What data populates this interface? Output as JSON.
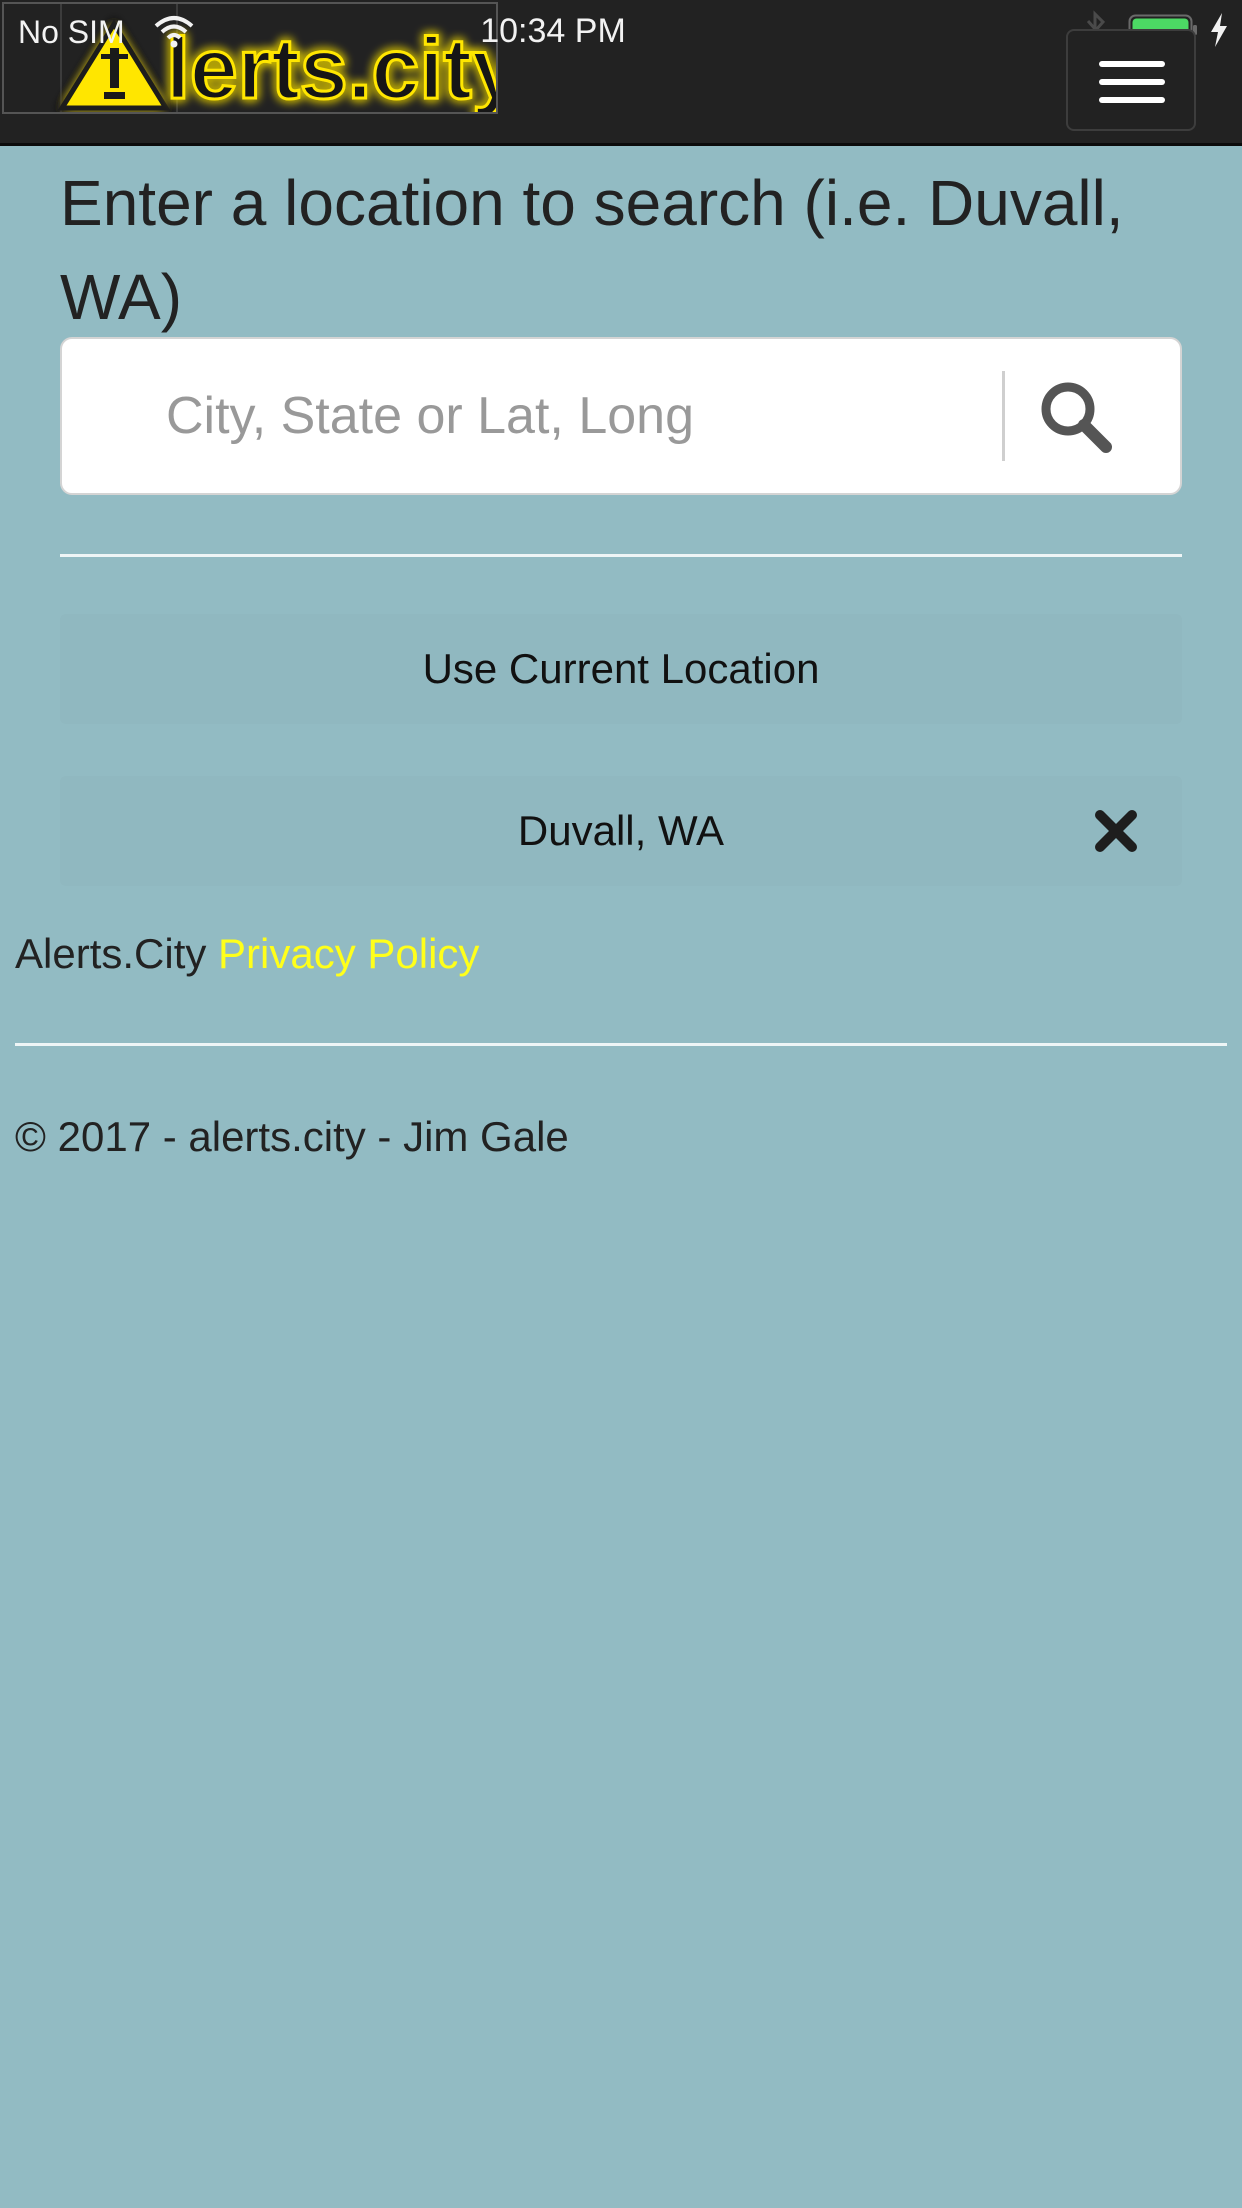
{
  "status_bar": {
    "carrier": "No SIM",
    "time": "10:34 PM",
    "battery_color": "#4cd964"
  },
  "navbar": {
    "logo_text": "Alerts.city",
    "logo_color": "#ffff00",
    "background": "#222222"
  },
  "search": {
    "prompt": "Enter a location to search (i.e. Duvall, WA)",
    "placeholder": "City, State or Lat, Long"
  },
  "locations": {
    "current_label": "Use Current Location",
    "saved": [
      {
        "label": "Duvall, WA"
      }
    ]
  },
  "footer": {
    "site_name": "Alerts.City",
    "privacy_label": "Privacy Policy",
    "privacy_color": "#ffff1a",
    "copyright": "© 2017 - alerts.city - Jim Gale"
  },
  "theme": {
    "page_background": "#92bbc3"
  }
}
